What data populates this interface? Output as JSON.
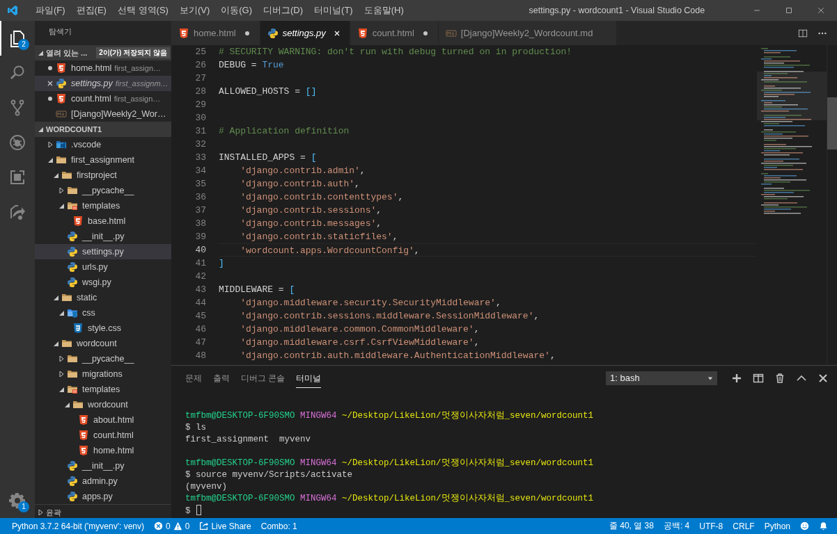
{
  "window": {
    "title": "settings.py - wordcount1 - Visual Studio Code"
  },
  "menu": [
    "파일(F)",
    "편집(E)",
    "선택 영역(S)",
    "보기(V)",
    "이동(G)",
    "디버그(D)",
    "터미널(T)",
    "도움말(H)"
  ],
  "activity_bar": {
    "items": [
      {
        "selected": true,
        "badge": "2"
      },
      {
        "selected": false
      },
      {
        "selected": false
      },
      {
        "selected": false
      },
      {
        "selected": false
      },
      {
        "selected": false
      }
    ],
    "settings_badge": "1"
  },
  "sidebar": {
    "title": "탐색기",
    "open_editors": {
      "title": "열려 있는 ...",
      "badge": "2이(가) 저장되지 않음",
      "expanded": true,
      "items": [
        {
          "name": "home.html",
          "path": "first_assign…",
          "kind": "html",
          "dirty": true,
          "preview": false,
          "selected": false
        },
        {
          "name": "settings.py",
          "path": "first_assignm…",
          "kind": "python",
          "dirty": false,
          "preview": true,
          "selected": true
        },
        {
          "name": "count.html",
          "path": "first_assign…",
          "kind": "html",
          "dirty": true,
          "preview": false,
          "selected": false
        },
        {
          "name": "[Django]Weekly2_Wor…",
          "kind": "markdown",
          "dirty": false,
          "preview": false,
          "selected": false
        }
      ]
    },
    "folder": {
      "title": "WORDCOUNT1",
      "expanded": true,
      "tree": [
        {
          "name": ".vscode",
          "kind": "folder-vscode",
          "expanded": false,
          "selected": false
        },
        {
          "name": "first_assignment",
          "kind": "folder",
          "expanded": true,
          "selected": false,
          "children": [
            {
              "name": "firstproject",
              "kind": "folder",
              "expanded": true,
              "selected": false,
              "children": [
                {
                  "name": "__pycache__",
                  "kind": "folder",
                  "expanded": false,
                  "selected": false
                },
                {
                  "name": "templates",
                  "kind": "folder-templates",
                  "expanded": true,
                  "selected": false,
                  "children": [
                    {
                      "name": "base.html",
                      "kind": "html",
                      "selected": false
                    }
                  ]
                },
                {
                  "name": "__init__.py",
                  "kind": "python",
                  "selected": false
                },
                {
                  "name": "settings.py",
                  "kind": "python",
                  "selected": true
                },
                {
                  "name": "urls.py",
                  "kind": "python",
                  "selected": false
                },
                {
                  "name": "wsgi.py",
                  "kind": "python",
                  "selected": false
                }
              ]
            },
            {
              "name": "static",
              "kind": "folder",
              "expanded": true,
              "selected": false,
              "children": [
                {
                  "name": "css",
                  "kind": "folder-css",
                  "expanded": true,
                  "selected": false,
                  "children": [
                    {
                      "name": "style.css",
                      "kind": "css",
                      "selected": false
                    }
                  ]
                }
              ]
            },
            {
              "name": "wordcount",
              "kind": "folder",
              "expanded": true,
              "selected": false,
              "children": [
                {
                  "name": "__pycache__",
                  "kind": "folder",
                  "expanded": false,
                  "selected": false
                },
                {
                  "name": "migrations",
                  "kind": "folder",
                  "expanded": false,
                  "selected": false
                },
                {
                  "name": "templates",
                  "kind": "folder-templates",
                  "expanded": true,
                  "selected": false,
                  "children": [
                    {
                      "name": "wordcount",
                      "kind": "folder",
                      "expanded": true,
                      "selected": false,
                      "children": [
                        {
                          "name": "about.html",
                          "kind": "html",
                          "selected": false
                        },
                        {
                          "name": "count.html",
                          "kind": "html",
                          "selected": false
                        },
                        {
                          "name": "home.html",
                          "kind": "html",
                          "selected": false
                        }
                      ]
                    }
                  ]
                },
                {
                  "name": "__init__.py",
                  "kind": "python",
                  "selected": false
                },
                {
                  "name": "admin.py",
                  "kind": "python",
                  "selected": false
                },
                {
                  "name": "apps.py",
                  "kind": "python",
                  "selected": false
                }
              ]
            }
          ]
        }
      ]
    },
    "outline": {
      "title": "윤곽",
      "expanded": false
    }
  },
  "tabs": [
    {
      "label": "home.html",
      "kind": "html",
      "dirty": true,
      "preview": false,
      "selected": false
    },
    {
      "label": "settings.py",
      "kind": "python",
      "dirty": false,
      "preview": true,
      "selected": true
    },
    {
      "label": "count.html",
      "kind": "html",
      "dirty": true,
      "preview": false,
      "selected": false
    },
    {
      "label": "[Django]Weekly2_Wordcount.md",
      "kind": "markdown",
      "dirty": false,
      "preview": false,
      "selected": false
    }
  ],
  "editor": {
    "lines": [
      {
        "number": "25",
        "current": false,
        "tokens": [
          {
            "kind": "comment",
            "text": "# SECURITY WARNING: don't run with debug turned on in production!"
          }
        ]
      },
      {
        "number": "26",
        "current": false,
        "tokens": [
          {
            "kind": "plain",
            "text": "DEBUG = "
          },
          {
            "kind": "keyword",
            "text": "True"
          }
        ]
      },
      {
        "number": "27",
        "current": false
      },
      {
        "number": "28",
        "current": false,
        "tokens": [
          {
            "kind": "plain",
            "text": "ALLOWED_HOSTS = "
          },
          {
            "kind": "bracket",
            "text": "[]"
          }
        ]
      },
      {
        "number": "29",
        "current": false
      },
      {
        "number": "30",
        "current": false
      },
      {
        "number": "31",
        "current": false,
        "tokens": [
          {
            "kind": "comment",
            "text": "# Application definition"
          }
        ]
      },
      {
        "number": "32",
        "current": false
      },
      {
        "number": "33",
        "current": false,
        "tokens": [
          {
            "kind": "plain",
            "text": "INSTALLED_APPS = "
          },
          {
            "kind": "bracket",
            "text": "["
          }
        ]
      },
      {
        "number": "34",
        "current": false,
        "tokens": [
          {
            "kind": "string",
            "text": "    'django.contrib.admin'"
          },
          {
            "kind": "plain",
            "text": ","
          }
        ]
      },
      {
        "number": "35",
        "current": false,
        "tokens": [
          {
            "kind": "string",
            "text": "    'django.contrib.auth'"
          },
          {
            "kind": "plain",
            "text": ","
          }
        ]
      },
      {
        "number": "36",
        "current": false,
        "tokens": [
          {
            "kind": "string",
            "text": "    'django.contrib.contenttypes'"
          },
          {
            "kind": "plain",
            "text": ","
          }
        ]
      },
      {
        "number": "37",
        "current": false,
        "tokens": [
          {
            "kind": "string",
            "text": "    'django.contrib.sessions'"
          },
          {
            "kind": "plain",
            "text": ","
          }
        ]
      },
      {
        "number": "38",
        "current": false,
        "tokens": [
          {
            "kind": "string",
            "text": "    'django.contrib.messages'"
          },
          {
            "kind": "plain",
            "text": ","
          }
        ]
      },
      {
        "number": "39",
        "current": false,
        "tokens": [
          {
            "kind": "string",
            "text": "    'django.contrib.staticfiles'"
          },
          {
            "kind": "plain",
            "text": ","
          }
        ]
      },
      {
        "number": "40",
        "current": true,
        "tokens": [
          {
            "kind": "string",
            "text": "    'wordcount.apps.WordcountConfig'"
          },
          {
            "kind": "plain",
            "text": ","
          }
        ]
      },
      {
        "number": "41",
        "current": false,
        "tokens": [
          {
            "kind": "bracket",
            "text": "]"
          }
        ]
      },
      {
        "number": "42",
        "current": false
      },
      {
        "number": "43",
        "current": false,
        "tokens": [
          {
            "kind": "plain",
            "text": "MIDDLEWARE = "
          },
          {
            "kind": "bracket",
            "text": "["
          }
        ]
      },
      {
        "number": "44",
        "current": false,
        "tokens": [
          {
            "kind": "string",
            "text": "    'django.middleware.security.SecurityMiddleware'"
          },
          {
            "kind": "plain",
            "text": ","
          }
        ]
      },
      {
        "number": "45",
        "current": false,
        "tokens": [
          {
            "kind": "string",
            "text": "    'django.contrib.sessions.middleware.SessionMiddleware'"
          },
          {
            "kind": "plain",
            "text": ","
          }
        ]
      },
      {
        "number": "46",
        "current": false,
        "tokens": [
          {
            "kind": "string",
            "text": "    'django.middleware.common.CommonMiddleware'"
          },
          {
            "kind": "plain",
            "text": ","
          }
        ]
      },
      {
        "number": "47",
        "current": false,
        "tokens": [
          {
            "kind": "string",
            "text": "    'django.middleware.csrf.CsrfViewMiddleware'"
          },
          {
            "kind": "plain",
            "text": ","
          }
        ]
      },
      {
        "number": "48",
        "current": false,
        "tokens": [
          {
            "kind": "string",
            "text": "    'django.contrib.auth.middleware.AuthenticationMiddleware'"
          },
          {
            "kind": "plain",
            "text": ","
          }
        ]
      }
    ]
  },
  "panel": {
    "tabs": [
      {
        "label": "문제",
        "selected": false
      },
      {
        "label": "출력",
        "selected": false
      },
      {
        "label": "디버그 콘솔",
        "selected": false
      },
      {
        "label": "터미널",
        "selected": true
      }
    ],
    "terminal_select": "1: bash",
    "terminal": [
      {
        "kind": "text",
        "spans": [
          {
            "kind": "user",
            "text": "tmfbm@DESKTOP-6F90SMO"
          },
          {
            "kind": "host",
            "text": "MINGW64"
          },
          {
            "kind": "path",
            "text": "~/Desktop/LikeLion/멋쟁이사자처럼_seven/wordcount1"
          }
        ]
      },
      {
        "kind": "text",
        "spans": [
          {
            "kind": "plain",
            "text": "$ ls"
          }
        ]
      },
      {
        "kind": "text",
        "spans": [
          {
            "kind": "plain",
            "text": "first_assignment  myvenv"
          }
        ]
      },
      {
        "kind": "blank"
      },
      {
        "kind": "text",
        "spans": [
          {
            "kind": "user",
            "text": "tmfbm@DESKTOP-6F90SMO"
          },
          {
            "kind": "host",
            "text": "MINGW64"
          },
          {
            "kind": "path",
            "text": "~/Desktop/LikeLion/멋쟁이사자처럼_seven/wordcount1"
          }
        ]
      },
      {
        "kind": "text",
        "spans": [
          {
            "kind": "plain",
            "text": "$ source myvenv/Scripts/activate"
          }
        ]
      },
      {
        "kind": "text",
        "spans": [
          {
            "kind": "plain",
            "text": "(myvenv)"
          }
        ]
      },
      {
        "kind": "text",
        "spans": [
          {
            "kind": "user",
            "text": "tmfbm@DESKTOP-6F90SMO"
          },
          {
            "kind": "host",
            "text": "MINGW64"
          },
          {
            "kind": "path",
            "text": "~/Desktop/LikeLion/멋쟁이사자처럼_seven/wordcount1"
          }
        ]
      },
      {
        "kind": "input",
        "spans": [
          {
            "kind": "plain",
            "text": "$"
          }
        ]
      }
    ]
  },
  "status_bar": {
    "interpreter": "Python 3.7.2 64-bit ('myvenv': venv)",
    "errors": "0",
    "warnings": "0",
    "live_share": "Live Share",
    "combo": "Combo: 1",
    "position": "줄 40, 열 38",
    "indent": "공백: 4",
    "encoding": "UTF-8",
    "eol": "CRLF",
    "language": "Python"
  }
}
